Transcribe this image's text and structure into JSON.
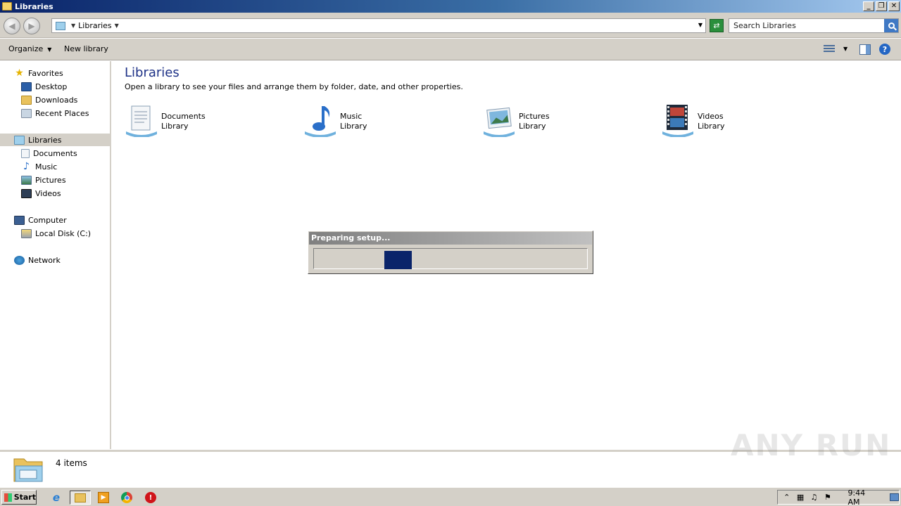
{
  "window": {
    "title": "Libraries",
    "buttons": {
      "minimize": "_",
      "restore": "❐",
      "close": "✕"
    }
  },
  "address": {
    "breadcrumb": "Libraries",
    "search_placeholder": "Search Libraries"
  },
  "commands": {
    "organize": "Organize",
    "new_library": "New library"
  },
  "nav": {
    "favorites": {
      "label": "Favorites",
      "items": [
        "Desktop",
        "Downloads",
        "Recent Places"
      ]
    },
    "libraries": {
      "label": "Libraries",
      "items": [
        "Documents",
        "Music",
        "Pictures",
        "Videos"
      ]
    },
    "computer": {
      "label": "Computer",
      "items": [
        "Local Disk (C:)"
      ]
    },
    "network": {
      "label": "Network"
    }
  },
  "content": {
    "title": "Libraries",
    "subtitle": "Open a library to see your files and arrange them by folder, date, and other properties.",
    "libraries": [
      {
        "name": "Documents",
        "type": "Library",
        "icon": "documents-library-icon"
      },
      {
        "name": "Music",
        "type": "Library",
        "icon": "music-library-icon"
      },
      {
        "name": "Pictures",
        "type": "Library",
        "icon": "pictures-library-icon"
      },
      {
        "name": "Videos",
        "type": "Library",
        "icon": "videos-library-icon"
      }
    ]
  },
  "status": {
    "item_count": "4 items",
    "watermark": "ANY RUN"
  },
  "setup_dialog": {
    "title": "Preparing setup...",
    "progress": 0.1
  },
  "taskbar": {
    "start": "Start",
    "clock": "9:44 AM"
  }
}
